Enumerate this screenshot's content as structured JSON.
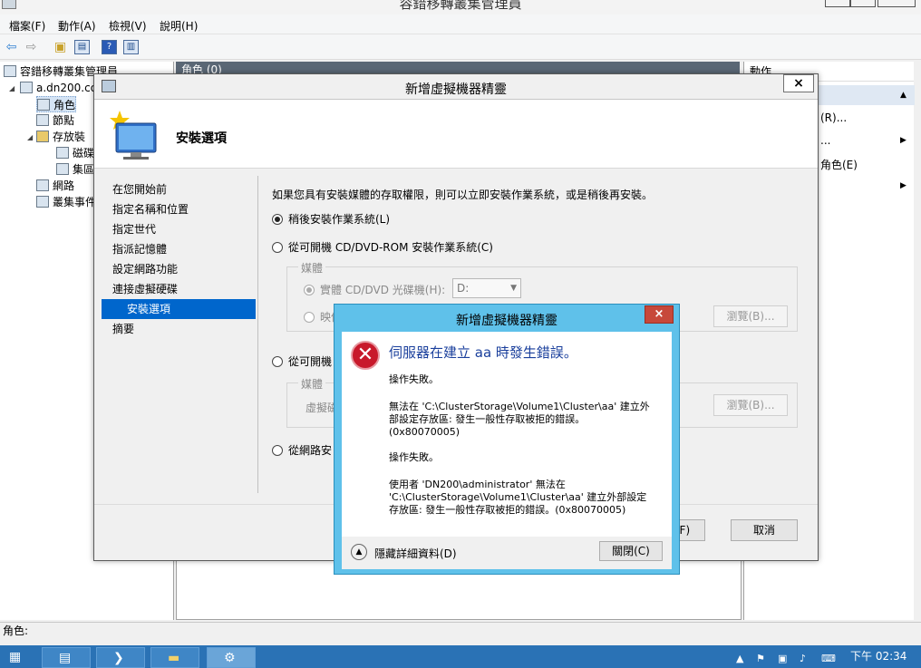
{
  "app": {
    "title": "容錯移轉叢集管理員"
  },
  "menu": [
    "檔案(F)",
    "動作(A)",
    "檢視(V)",
    "說明(H)"
  ],
  "tree": {
    "root": "容錯移轉叢集管理員",
    "cluster": "a.dn200.co",
    "items": [
      "角色",
      "節點",
      "存放裝",
      "磁碟",
      "集區",
      "網路",
      "叢集事件"
    ]
  },
  "center": {
    "header": "角色 (0)"
  },
  "actions": {
    "header": "動作",
    "items": [
      "(R)...",
      "...",
      "角色(E)"
    ]
  },
  "statusbar": {
    "text": "角色:"
  },
  "taskbar": {
    "time": "下午 02:34"
  },
  "wizard": {
    "title": "新增虛擬機器精靈",
    "close_label": "×",
    "header_title": "安裝選項",
    "nav": [
      "在您開始前",
      "指定名稱和位置",
      "指定世代",
      "指派記憶體",
      "設定網路功能",
      "連接虛擬硬碟",
      "安裝選項",
      "摘要"
    ],
    "intro": "如果您具有安裝媒體的存取權限，則可以立即安裝作業系統，或是稍後再安裝。",
    "option_later": "稍後安裝作業系統(L)",
    "option_dvd": "從可開機 CD/DVD-ROM 安裝作業系統(C)",
    "media_group_label": "媒體",
    "physical_drive": "實體 CD/DVD 光碟機(H):",
    "drive_value": "D:",
    "image_file": "映像",
    "browse_1": "瀏覽(B)...",
    "option_floppy": "從可開機",
    "media_group_label_2": "媒體",
    "virtual_floppy": "虛擬磁",
    "browse_2": "瀏覽(B)...",
    "option_network": "從網路安",
    "finish": "完成(F)",
    "cancel": "取消"
  },
  "error_dialog": {
    "title": "新增虛擬機器精靈",
    "close_label": "×",
    "heading": "伺服器在建立 aa 時發生錯誤。",
    "block1": "操作失敗。",
    "block2": "無法在 'C:\\ClusterStorage\\Volume1\\Cluster\\aa' 建立外\n部設定存放區: 發生一般性存取被拒的錯誤。\n(0x80070005)",
    "block3": "操作失敗。",
    "block4": "使用者 'DN200\\administrator' 無法在\n'C:\\ClusterStorage\\Volume1\\Cluster\\aa' 建立外部設定\n存放區: 發生一般性存取被拒的錯誤。(0x80070005)",
    "details_toggle": "隱藏詳細資料(D)",
    "close_button": "關閉(C)"
  }
}
